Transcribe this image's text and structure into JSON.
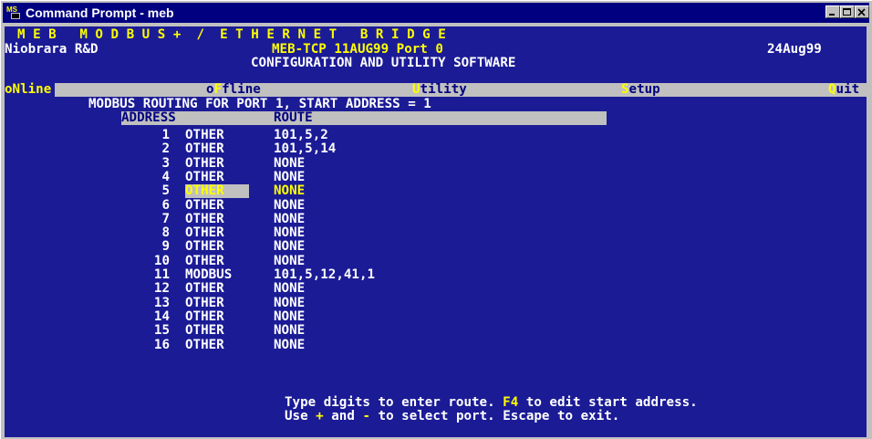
{
  "window": {
    "title": "Command Prompt - meb",
    "icon": "ms-dos-icon",
    "controls": [
      "minimize-icon",
      "maximize-icon",
      "close-icon"
    ]
  },
  "banner": {
    "title": "M E B   M O D B U S +  /  E T H E R N E T   B R I D G E",
    "company": "Niobrara R&D",
    "date": "24Aug99",
    "version": "MEB-TCP 11AUG99 Port 0",
    "subtitle": "CONFIGURATION AND UTILITY SOFTWARE"
  },
  "menu": {
    "online": "oNline",
    "offline": {
      "pre": "o",
      "hot": "F",
      "post": "fline"
    },
    "utility": {
      "hot": "U",
      "post": "tility"
    },
    "setup": {
      "hot": "S",
      "post": "etup"
    },
    "quit": {
      "hot": "Q",
      "post": "uit"
    }
  },
  "routing": {
    "heading": "MODBUS ROUTING FOR PORT 1, START ADDRESS = 1",
    "col_address": "ADDRESS",
    "col_route": "ROUTE",
    "selected_row": 5,
    "rows": [
      {
        "address": "1",
        "type": "OTHER",
        "route": "101,5,2"
      },
      {
        "address": "2",
        "type": "OTHER",
        "route": "101,5,14"
      },
      {
        "address": "3",
        "type": "OTHER",
        "route": "NONE"
      },
      {
        "address": "4",
        "type": "OTHER",
        "route": "NONE"
      },
      {
        "address": "5",
        "type": "OTHER",
        "route": "NONE"
      },
      {
        "address": "6",
        "type": "OTHER",
        "route": "NONE"
      },
      {
        "address": "7",
        "type": "OTHER",
        "route": "NONE"
      },
      {
        "address": "8",
        "type": "OTHER",
        "route": "NONE"
      },
      {
        "address": "9",
        "type": "OTHER",
        "route": "NONE"
      },
      {
        "address": "10",
        "type": "OTHER",
        "route": "NONE"
      },
      {
        "address": "11",
        "type": "MODBUS",
        "route": "101,5,12,41,1"
      },
      {
        "address": "12",
        "type": "OTHER",
        "route": "NONE"
      },
      {
        "address": "13",
        "type": "OTHER",
        "route": "NONE"
      },
      {
        "address": "14",
        "type": "OTHER",
        "route": "NONE"
      },
      {
        "address": "15",
        "type": "OTHER",
        "route": "NONE"
      },
      {
        "address": "16",
        "type": "OTHER",
        "route": "NONE"
      }
    ]
  },
  "help": {
    "line1_pre": "Type digits to enter route. ",
    "line1_key": "F4",
    "line1_post": " to edit start address.",
    "line2_pre": "Use ",
    "line2_plus": "+",
    "line2_mid": " and ",
    "line2_minus": "-",
    "line2_post": " to select port. Escape to exit."
  },
  "colors": {
    "console_bg": "#1b1b96",
    "text": "#ffffff",
    "highlight": "#ffff00",
    "bar_bg": "#c0c0c0",
    "titlebar": "#000080"
  }
}
